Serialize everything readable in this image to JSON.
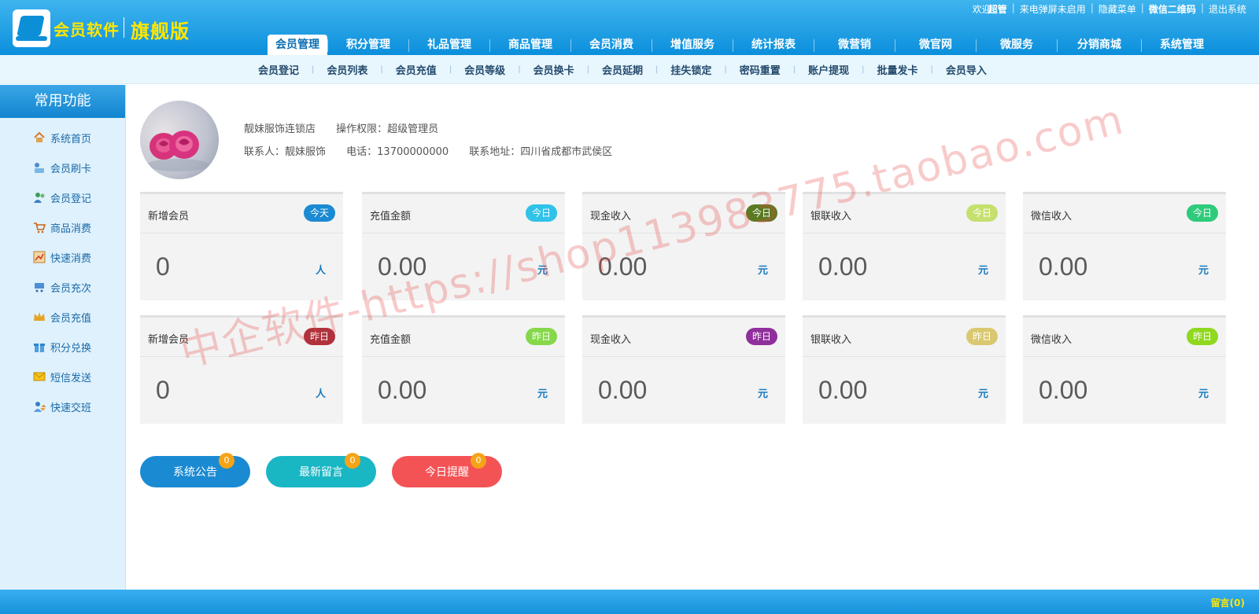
{
  "header": {
    "app_name": "会员软件",
    "edition": "旗舰版",
    "top_links": {
      "welcome": "欢迎",
      "user": "超管",
      "popup_status": "来电弹屏未启用",
      "hide_menu": "隐藏菜单",
      "wechat_qr": "微信二维码",
      "logout": "退出系统"
    },
    "nav": [
      "会员管理",
      "积分管理",
      "礼品管理",
      "商品管理",
      "会员消费",
      "增值服务",
      "统计报表",
      "微营销",
      "微官网",
      "微服务",
      "分销商城",
      "系统管理"
    ],
    "active_tab": 0
  },
  "subnav": [
    "会员登记",
    "会员列表",
    "会员充值",
    "会员等级",
    "会员换卡",
    "会员延期",
    "挂失锁定",
    "密码重置",
    "账户提现",
    "批量发卡",
    "会员导入"
  ],
  "sidebar": {
    "title": "常用功能",
    "items": [
      {
        "label": "系统首页",
        "icon": "home-icon"
      },
      {
        "label": "会员刷卡",
        "icon": "card-swipe-icon"
      },
      {
        "label": "会员登记",
        "icon": "user-add-icon"
      },
      {
        "label": "商品消费",
        "icon": "cart-icon"
      },
      {
        "label": "快速消费",
        "icon": "chart-icon"
      },
      {
        "label": "会员充次",
        "icon": "cart-plus-icon"
      },
      {
        "label": "会员充值",
        "icon": "crown-icon"
      },
      {
        "label": "积分兑换",
        "icon": "gift-icon"
      },
      {
        "label": "短信发送",
        "icon": "mail-icon"
      },
      {
        "label": "快速交班",
        "icon": "user-switch-icon"
      }
    ]
  },
  "store": {
    "name": "靓妹服饰连锁店",
    "permission": "操作权限：超级管理员",
    "contact": "联系人：靓妹服饰",
    "phone": "电话：13700000000",
    "address": "联系地址：四川省成都市武侯区"
  },
  "stats_today": [
    {
      "label": "新增会员",
      "badge": "今天",
      "badge_color": "#1a8ad3",
      "value": "0",
      "unit": "人"
    },
    {
      "label": "充值金额",
      "badge": "今日",
      "badge_color": "#30c2e8",
      "value": "0.00",
      "unit": "元"
    },
    {
      "label": "现金收入",
      "badge": "今日",
      "badge_color": "#5c7a22",
      "value": "0.00",
      "unit": "元"
    },
    {
      "label": "银联收入",
      "badge": "今日",
      "badge_color": "#c6e070",
      "value": "0.00",
      "unit": "元"
    },
    {
      "label": "微信收入",
      "badge": "今日",
      "badge_color": "#2ecb7a",
      "value": "0.00",
      "unit": "元"
    }
  ],
  "stats_yesterday": [
    {
      "label": "新增会员",
      "badge": "昨日",
      "badge_color": "#b0323c",
      "value": "0",
      "unit": "人"
    },
    {
      "label": "充值金额",
      "badge": "昨日",
      "badge_color": "#86d84a",
      "value": "0.00",
      "unit": "元"
    },
    {
      "label": "现金收入",
      "badge": "昨日",
      "badge_color": "#8f2f9c",
      "value": "0.00",
      "unit": "元"
    },
    {
      "label": "银联收入",
      "badge": "昨日",
      "badge_color": "#d9c870",
      "value": "0.00",
      "unit": "元"
    },
    {
      "label": "微信收入",
      "badge": "昨日",
      "badge_color": "#8fd81f",
      "value": "0.00",
      "unit": "元"
    }
  ],
  "pills": [
    {
      "label": "系统公告",
      "count": "0",
      "color": "#1a8ad3"
    },
    {
      "label": "最新留言",
      "count": "0",
      "color": "#19b6c4"
    },
    {
      "label": "今日提醒",
      "count": "0",
      "color": "#f45356"
    }
  ],
  "footer": {
    "messages": "留言(0)"
  },
  "watermark": "中企软件-https://shop113983775.taobao.com"
}
